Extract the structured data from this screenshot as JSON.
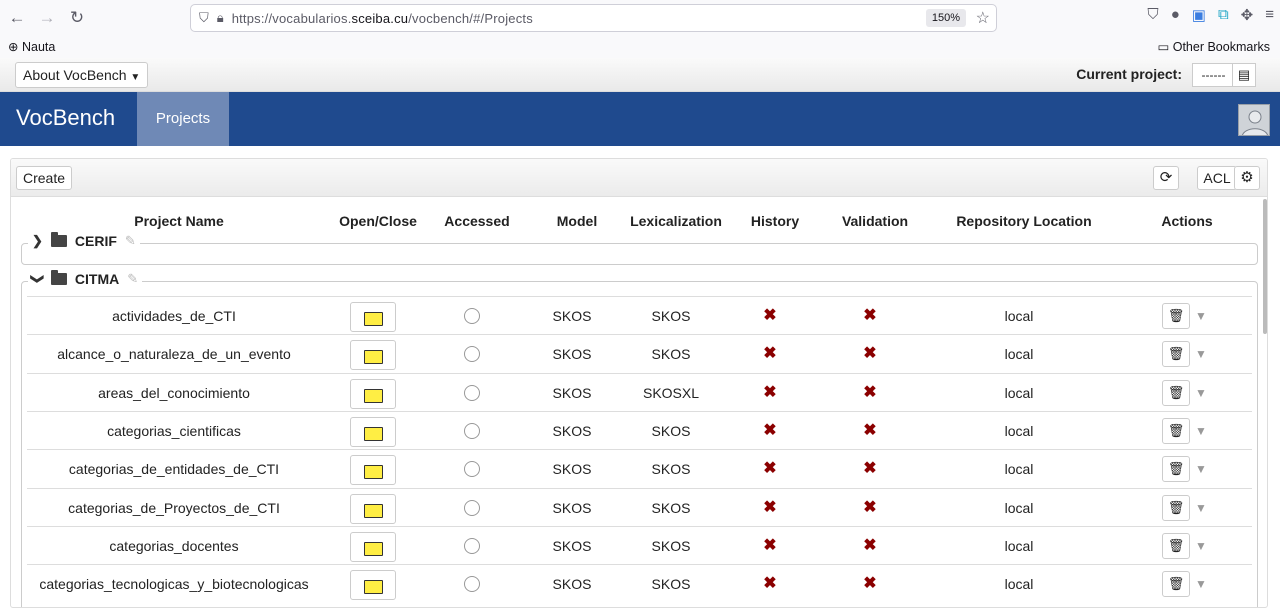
{
  "browser": {
    "url_prefix": "https://vocabularios.",
    "url_domain": "sceiba.cu",
    "url_path": "/vocbench/#/Projects",
    "zoom": "150%",
    "bookmark_nauta": "Nauta",
    "bookmark_other": "Other Bookmarks"
  },
  "topbar": {
    "about_label": "About VocBench",
    "current_project_label": "Current project:",
    "current_project_value": "------"
  },
  "navbar": {
    "brand": "VocBench",
    "projects_tab": "Projects"
  },
  "panel": {
    "create_label": "Create",
    "acl_label": "ACL"
  },
  "columns": {
    "name": "Project Name",
    "open_close": "Open/Close",
    "accessed": "Accessed",
    "model": "Model",
    "lexicalization": "Lexicalization",
    "history": "History",
    "validation": "Validation",
    "repository": "Repository Location",
    "actions": "Actions"
  },
  "groups": [
    {
      "name": "CERIF",
      "expanded": false
    },
    {
      "name": "CITMA",
      "expanded": true
    }
  ],
  "projects": [
    {
      "name": "actividades_de_CTI",
      "model": "SKOS",
      "lexicalization": "SKOS",
      "location": "local"
    },
    {
      "name": "alcance_o_naturaleza_de_un_evento",
      "model": "SKOS",
      "lexicalization": "SKOS",
      "location": "local"
    },
    {
      "name": "areas_del_conocimiento",
      "model": "SKOS",
      "lexicalization": "SKOSXL",
      "location": "local"
    },
    {
      "name": "categorias_cientificas",
      "model": "SKOS",
      "lexicalization": "SKOS",
      "location": "local"
    },
    {
      "name": "categorias_de_entidades_de_CTI",
      "model": "SKOS",
      "lexicalization": "SKOS",
      "location": "local"
    },
    {
      "name": "categorias_de_Proyectos_de_CTI",
      "model": "SKOS",
      "lexicalization": "SKOS",
      "location": "local"
    },
    {
      "name": "categorias_docentes",
      "model": "SKOS",
      "lexicalization": "SKOS",
      "location": "local"
    },
    {
      "name": "categorias_tecnologicas_y_biotecnologicas",
      "model": "SKOS",
      "lexicalization": "SKOS",
      "location": "local"
    }
  ],
  "icons": {
    "history_disabled": "x-mark-icon",
    "validation_disabled": "x-mark-icon",
    "x_color": "#8b0000",
    "navbar_color": "#1f4a8e",
    "active_tab_color": "#6f89b6"
  }
}
